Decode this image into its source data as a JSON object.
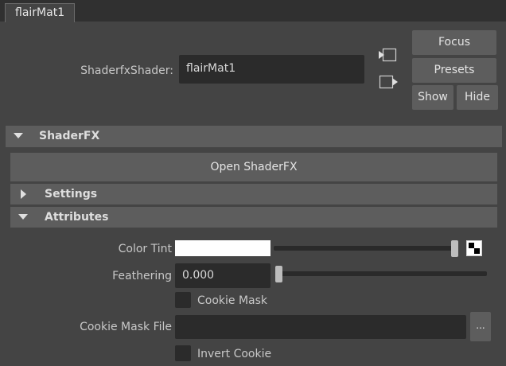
{
  "tab": {
    "label": "flairMat1"
  },
  "shader": {
    "type_label": "ShaderfxShader:",
    "name_value": "flairMat1"
  },
  "buttons": {
    "focus": "Focus",
    "presets": "Presets",
    "show": "Show",
    "hide": "Hide"
  },
  "sections": {
    "shaderfx": "ShaderFX",
    "open_shaderfx": "Open ShaderFX",
    "settings": "Settings",
    "attributes": "Attributes"
  },
  "attributes": {
    "color_tint_label": "Color Tint",
    "color_tint_color": "#ffffff",
    "feathering_label": "Feathering",
    "feathering_value": "0.000",
    "cookie_mask_label": "Cookie Mask",
    "cookie_mask_checked": false,
    "cookie_mask_file_label": "Cookie Mask File",
    "cookie_mask_file_value": "",
    "browse_label": "...",
    "invert_cookie_label": "Invert Cookie",
    "invert_cookie_checked": false
  }
}
